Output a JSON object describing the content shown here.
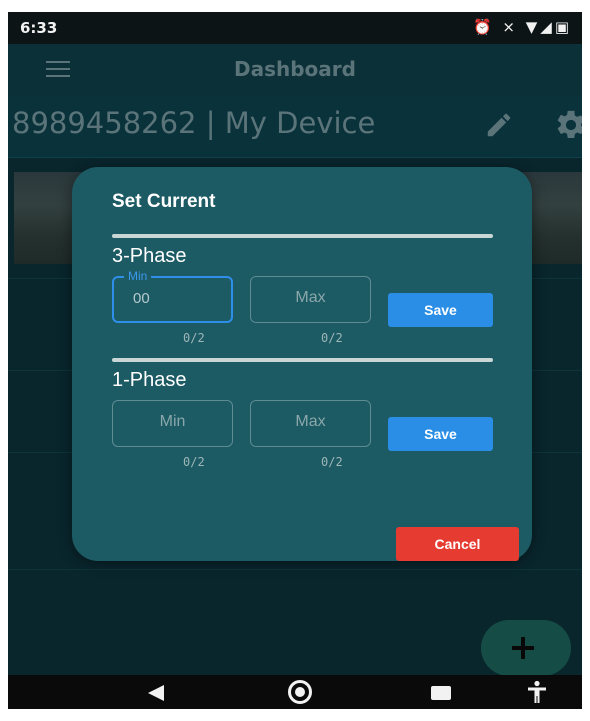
{
  "status_bar": {
    "time": "6:33",
    "icons": [
      "alarm-icon",
      "mute-icon",
      "wifi-icon",
      "signal-icon",
      "battery-icon"
    ],
    "icon_glyphs": "⏰ ⨯ ▼◢▣"
  },
  "app_bar": {
    "title": "Dashboard",
    "menu_icon": "hamburger-menu-icon"
  },
  "device_header": {
    "title": "8989458262 | My Device",
    "edit_icon": "pencil-icon",
    "settings_icon": "gear-icon"
  },
  "dialog": {
    "title": "Set Current",
    "three_phase": {
      "label": "3-Phase",
      "min_label": "Min",
      "min_value": "00",
      "min_counter": "0/2",
      "max_placeholder": "Max",
      "max_counter": "0/2",
      "save_label": "Save"
    },
    "one_phase": {
      "label": "1-Phase",
      "min_placeholder": "Min",
      "min_counter": "0/2",
      "max_placeholder": "Max",
      "max_counter": "0/2",
      "save_label": "Save"
    },
    "cancel_label": "Cancel"
  },
  "fab": {
    "icon": "plus-icon"
  },
  "nav_bar": {
    "icons": [
      "back-icon",
      "home-icon",
      "recents-icon",
      "accessibility-icon"
    ]
  },
  "colors": {
    "app_background": "#0b2f37",
    "dialog_background": "#1c5a64",
    "save_button": "#2a8ee6",
    "cancel_button": "#e53b30",
    "focus_accent": "#2f8fe8"
  }
}
